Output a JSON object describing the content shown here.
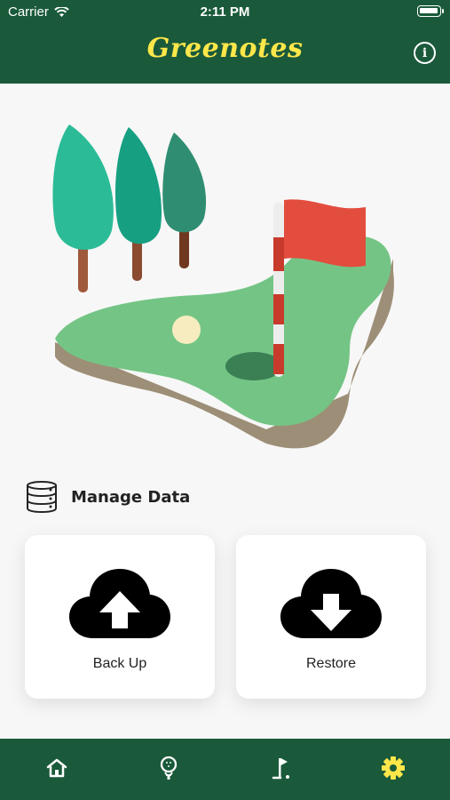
{
  "status_bar": {
    "carrier": "Carrier",
    "time": "2:11 PM"
  },
  "header": {
    "title": "Greenotes",
    "info_icon": "info-icon"
  },
  "section": {
    "title": "Manage Data",
    "icon": "database-icon"
  },
  "actions": [
    {
      "label": "Back Up",
      "icon": "cloud-upload-icon"
    },
    {
      "label": "Restore",
      "icon": "cloud-download-icon"
    }
  ],
  "tabbar": {
    "items": [
      {
        "icon": "home-icon"
      },
      {
        "icon": "golf-ball-icon"
      },
      {
        "icon": "golf-flag-icon"
      },
      {
        "icon": "settings-icon",
        "active": true
      }
    ]
  },
  "colors": {
    "header_bg": "#1a5a3a",
    "title": "#ffe74a",
    "active_tab": "#ffe74a",
    "inactive_tab": "#ffffff"
  }
}
